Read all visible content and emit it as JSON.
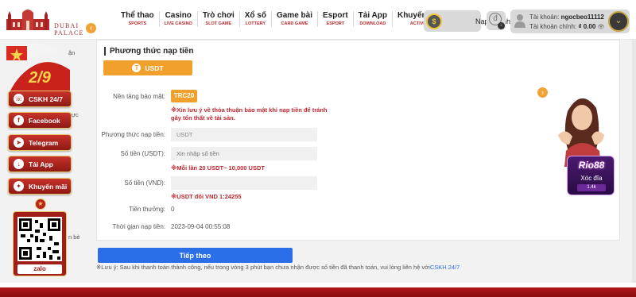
{
  "brand": {
    "logo_text": "DUBAI PALACE",
    "accent": "#c0272d",
    "orange": "#f0a02b",
    "blue": "#2a6ee8"
  },
  "nav": [
    {
      "label": "Thể thao",
      "sub": "SPORTS"
    },
    {
      "label": "Casino",
      "sub": "LIVE CASINO"
    },
    {
      "label": "Trò chơi",
      "sub": "SLOT GAME"
    },
    {
      "label": "Xổ số",
      "sub": "LOTTERY"
    },
    {
      "label": "Game bài",
      "sub": "CARD GAME"
    },
    {
      "label": "Esport",
      "sub": "ESPORT"
    },
    {
      "label": "Tải App",
      "sub": "DOWNLOAD"
    },
    {
      "label": "Khuyến mãi",
      "sub": "ACTIVITY"
    }
  ],
  "header": {
    "quick_deposit": "Nạp nhanh",
    "account_label": "Tài khoản:",
    "account_name": "ngocbeo11112",
    "main_account_label": "Tài khoản chính:",
    "main_balance": "₫ 0.00"
  },
  "sidebar": {
    "banner_text": "2/9",
    "buttons": [
      {
        "label": "CSKH 24/7",
        "icon": "headset-icon"
      },
      {
        "label": "Facebook",
        "icon": "facebook-icon"
      },
      {
        "label": "Telegram",
        "icon": "telegram-icon"
      },
      {
        "label": "Tải App",
        "icon": "download-icon"
      },
      {
        "label": "Khuyến mãi",
        "icon": "gift-icon"
      }
    ],
    "zalo_label": "zalo",
    "peek_texts": [
      "ận",
      "ực",
      "n bè"
    ]
  },
  "form": {
    "title": "Phương thức nạp tiền",
    "method_tab": "USDT",
    "network_label": "Nền tảng bảo mật:",
    "network_value": "TRC20",
    "security_warning": "※Xin lưu ý về thỏa thuận bảo mật khi nạp tiền để tránh gây tổn thất về tài sản.",
    "payment_method_label": "Phương thức nạp tiền:",
    "payment_method_value": "USDT",
    "amount_usdt_label": "Số tiền (USDT):",
    "amount_usdt_placeholder": "Xin nhập số tiền",
    "limit_warning": "※Mỗi lần 20 USDT~ 10,000 USDT",
    "amount_vnd_label": "Số tiền (VND):",
    "rate_warning": "※USDT đổi VND 1:24255",
    "bonus_label": "Tiền thưởng:",
    "bonus_value": "0",
    "time_label": "Thời gian nạp tiền:",
    "time_value": "2023-09-04 00:55:08",
    "continue_label": "Tiếp theo",
    "note_text": "※Lưu ý: Sau khi thanh toán thành công, nếu trong vòng 3 phút bạn chưa nhận được số tiền đã thanh toán, vui lòng liên hệ với",
    "note_link": "CSKH 24/7"
  },
  "promo": {
    "logo": "Rio88",
    "game": "Xóc đĩa",
    "plays": "1.4k"
  }
}
